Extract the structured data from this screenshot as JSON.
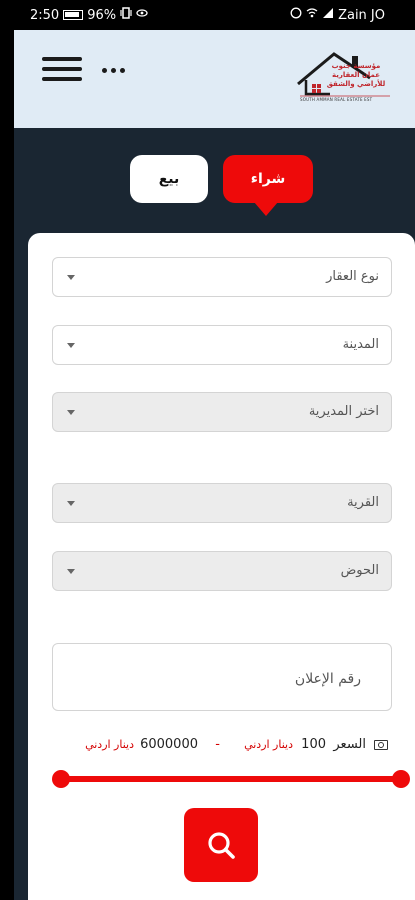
{
  "status_bar": {
    "time": "2:50",
    "battery_percent": "96%",
    "carrier": "Zain JO",
    "icons": [
      "battery-icon",
      "vibrate-icon",
      "eye-icon",
      "whatsapp-icon",
      "wifi-icon",
      "signal-icon"
    ]
  },
  "header": {
    "menu_icon": "hamburger-menu-icon",
    "more_icon": "more-dots-icon",
    "logo": {
      "text_ar": "مؤسسة جنوب عمان العقارية",
      "text_ar_sub": "للأراضي والشقق",
      "text_en": "SOUTH AMMAN REAL ESTATE EST"
    }
  },
  "tabs": {
    "sell_label": "بيع",
    "buy_label": "شراء",
    "active": "buy"
  },
  "form": {
    "property_type_placeholder": "نوع العقار",
    "city_placeholder": "المدينة",
    "directorate_placeholder": "اختر المديرية",
    "village_placeholder": "القرية",
    "basin_placeholder": "الحوض",
    "ad_number_placeholder": "رقم الإعلان",
    "price": {
      "label": "السعر",
      "min": "100",
      "min_unit": "دينار اردني",
      "separator": "-",
      "max": "6000000",
      "max_unit": "دينار اردني"
    }
  },
  "colors": {
    "accent": "#ee0a0a",
    "header_bg": "#e0ebf5",
    "page_bg": "#1a2632"
  },
  "search_icon": "search-icon"
}
